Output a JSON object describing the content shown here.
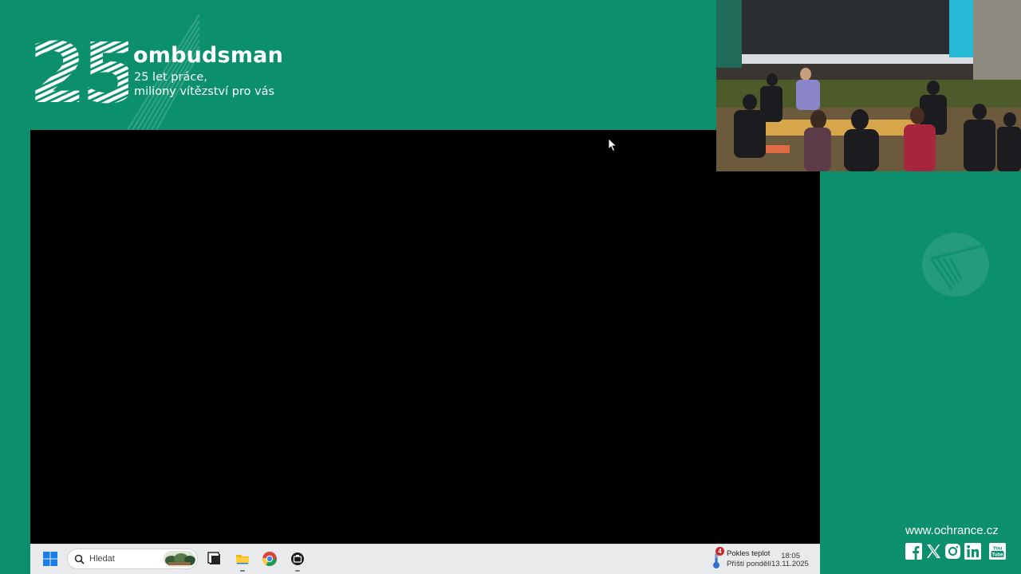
{
  "brand": {
    "number": "25",
    "name": "ombudsman",
    "tagline_line1": "25 let práce,",
    "tagline_line2": "miliony vítězství pro vás"
  },
  "taskbar": {
    "search_placeholder": "Hledat",
    "apps": [
      {
        "name": "windows-start",
        "icon": "windows-logo-icon"
      },
      {
        "name": "task-view",
        "icon": "task-view-icon"
      },
      {
        "name": "file-explorer",
        "icon": "folder-icon"
      },
      {
        "name": "chrome",
        "icon": "chrome-icon"
      },
      {
        "name": "app",
        "icon": "app-icon"
      }
    ],
    "weather": {
      "badge": "4",
      "title": "Pokles teplot",
      "subtitle": "Příští pondělí"
    },
    "clock": {
      "time": "18:05",
      "date": "13.11.2025"
    }
  },
  "footer": {
    "url": "www.ochrance.cz",
    "socials": [
      "facebook-icon",
      "x-icon",
      "instagram-icon",
      "linkedin-icon",
      "youtube-icon"
    ]
  },
  "colors": {
    "brand_green": "#0b8f6c",
    "screen": "#000000",
    "taskbar": "#e9eaec"
  }
}
